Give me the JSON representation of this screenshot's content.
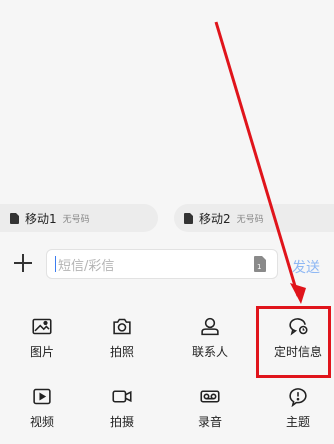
{
  "sims": [
    {
      "name": "移动1",
      "sub": "无号码"
    },
    {
      "name": "移动2",
      "sub": "无号码"
    }
  ],
  "composer": {
    "placeholder": "短信/彩信",
    "send_label": "发送"
  },
  "tools_row1": [
    {
      "label": "图片",
      "icon": "image-icon"
    },
    {
      "label": "拍照",
      "icon": "camera-icon"
    },
    {
      "label": "联系人",
      "icon": "contact-icon"
    },
    {
      "label": "定时信息",
      "icon": "scheduled-message-icon"
    }
  ],
  "tools_row2": [
    {
      "label": "视频",
      "icon": "video-icon"
    },
    {
      "label": "拍摄",
      "icon": "record-video-icon"
    },
    {
      "label": "录音",
      "icon": "voice-record-icon"
    },
    {
      "label": "主题",
      "icon": "theme-icon"
    }
  ],
  "colors": {
    "annotation": "#e0141b",
    "accent": "#3c7df0"
  }
}
